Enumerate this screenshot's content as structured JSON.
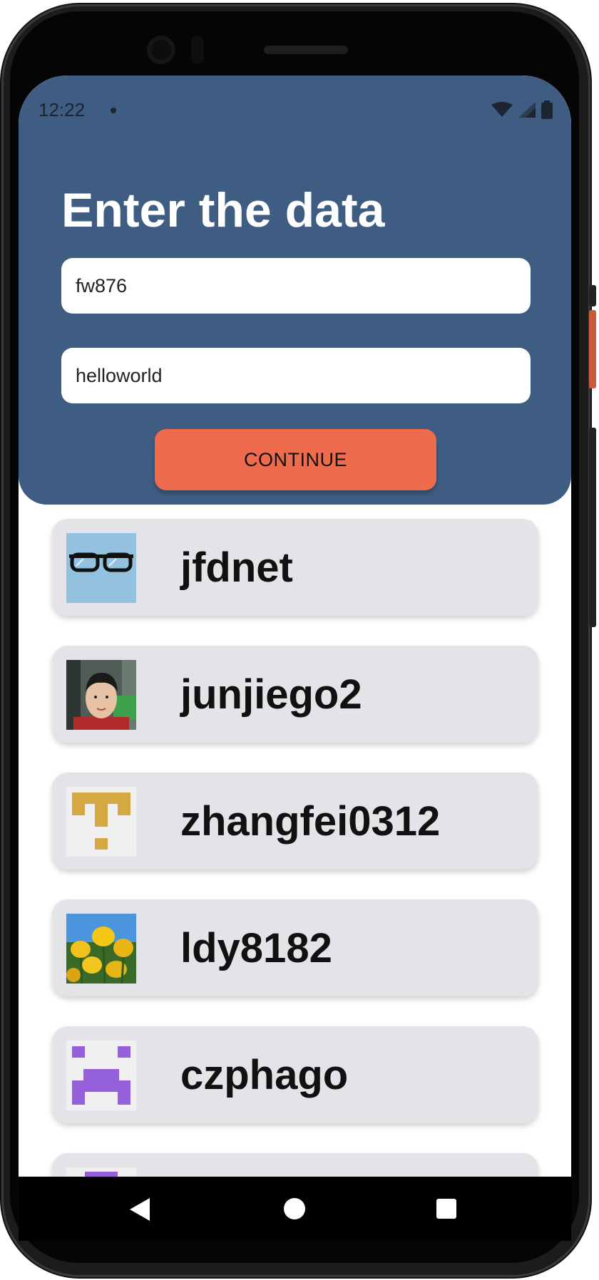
{
  "status_bar": {
    "time": "12:22"
  },
  "header": {
    "title": "Enter the data",
    "username_value": "fw876",
    "password_value": "helloworld",
    "continue_label": "CONTINUE"
  },
  "users": [
    {
      "name": "jfdnet",
      "avatar": "glasses-avatar"
    },
    {
      "name": "junjiego2",
      "avatar": "photo-portrait-avatar"
    },
    {
      "name": "zhangfei0312",
      "avatar": "identicon-gold"
    },
    {
      "name": "ldy8182",
      "avatar": "tulips-photo-avatar"
    },
    {
      "name": "czphago",
      "avatar": "identicon-purple"
    }
  ],
  "colors": {
    "header_bg": "#3f5c82",
    "button_bg": "#ef6b4e",
    "card_bg": "#e4e3e8",
    "identicon_gold": "#d4a944",
    "identicon_purple": "#9460dc"
  },
  "nav": {
    "back": "back-icon",
    "home": "home-icon",
    "recents": "recents-icon"
  }
}
